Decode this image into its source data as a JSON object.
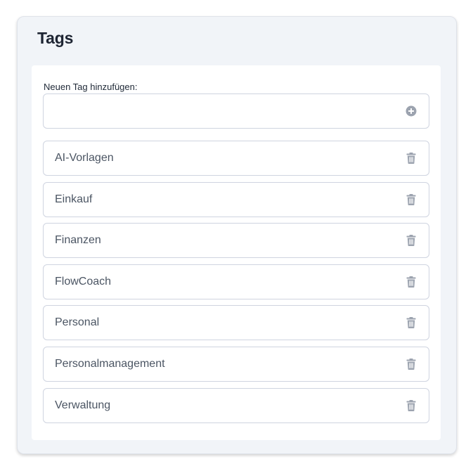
{
  "title": "Tags",
  "new_tag": {
    "label": "Neuen Tag hinzufügen:",
    "value": "",
    "placeholder": "",
    "add_icon": "plus-circle-icon"
  },
  "tags": [
    {
      "label": "AI-Vorlagen",
      "icon": "trash-icon"
    },
    {
      "label": "Einkauf",
      "icon": "trash-icon"
    },
    {
      "label": "Finanzen",
      "icon": "trash-icon"
    },
    {
      "label": "FlowCoach",
      "icon": "trash-icon"
    },
    {
      "label": "Personal",
      "icon": "trash-icon"
    },
    {
      "label": "Personalmanagement",
      "icon": "trash-icon"
    },
    {
      "label": "Verwaltung",
      "icon": "trash-icon"
    }
  ],
  "colors": {
    "card_background": "#f1f4f8",
    "icon": "#9ca3af",
    "text": "#4b5563",
    "border": "#cfd4e0"
  }
}
